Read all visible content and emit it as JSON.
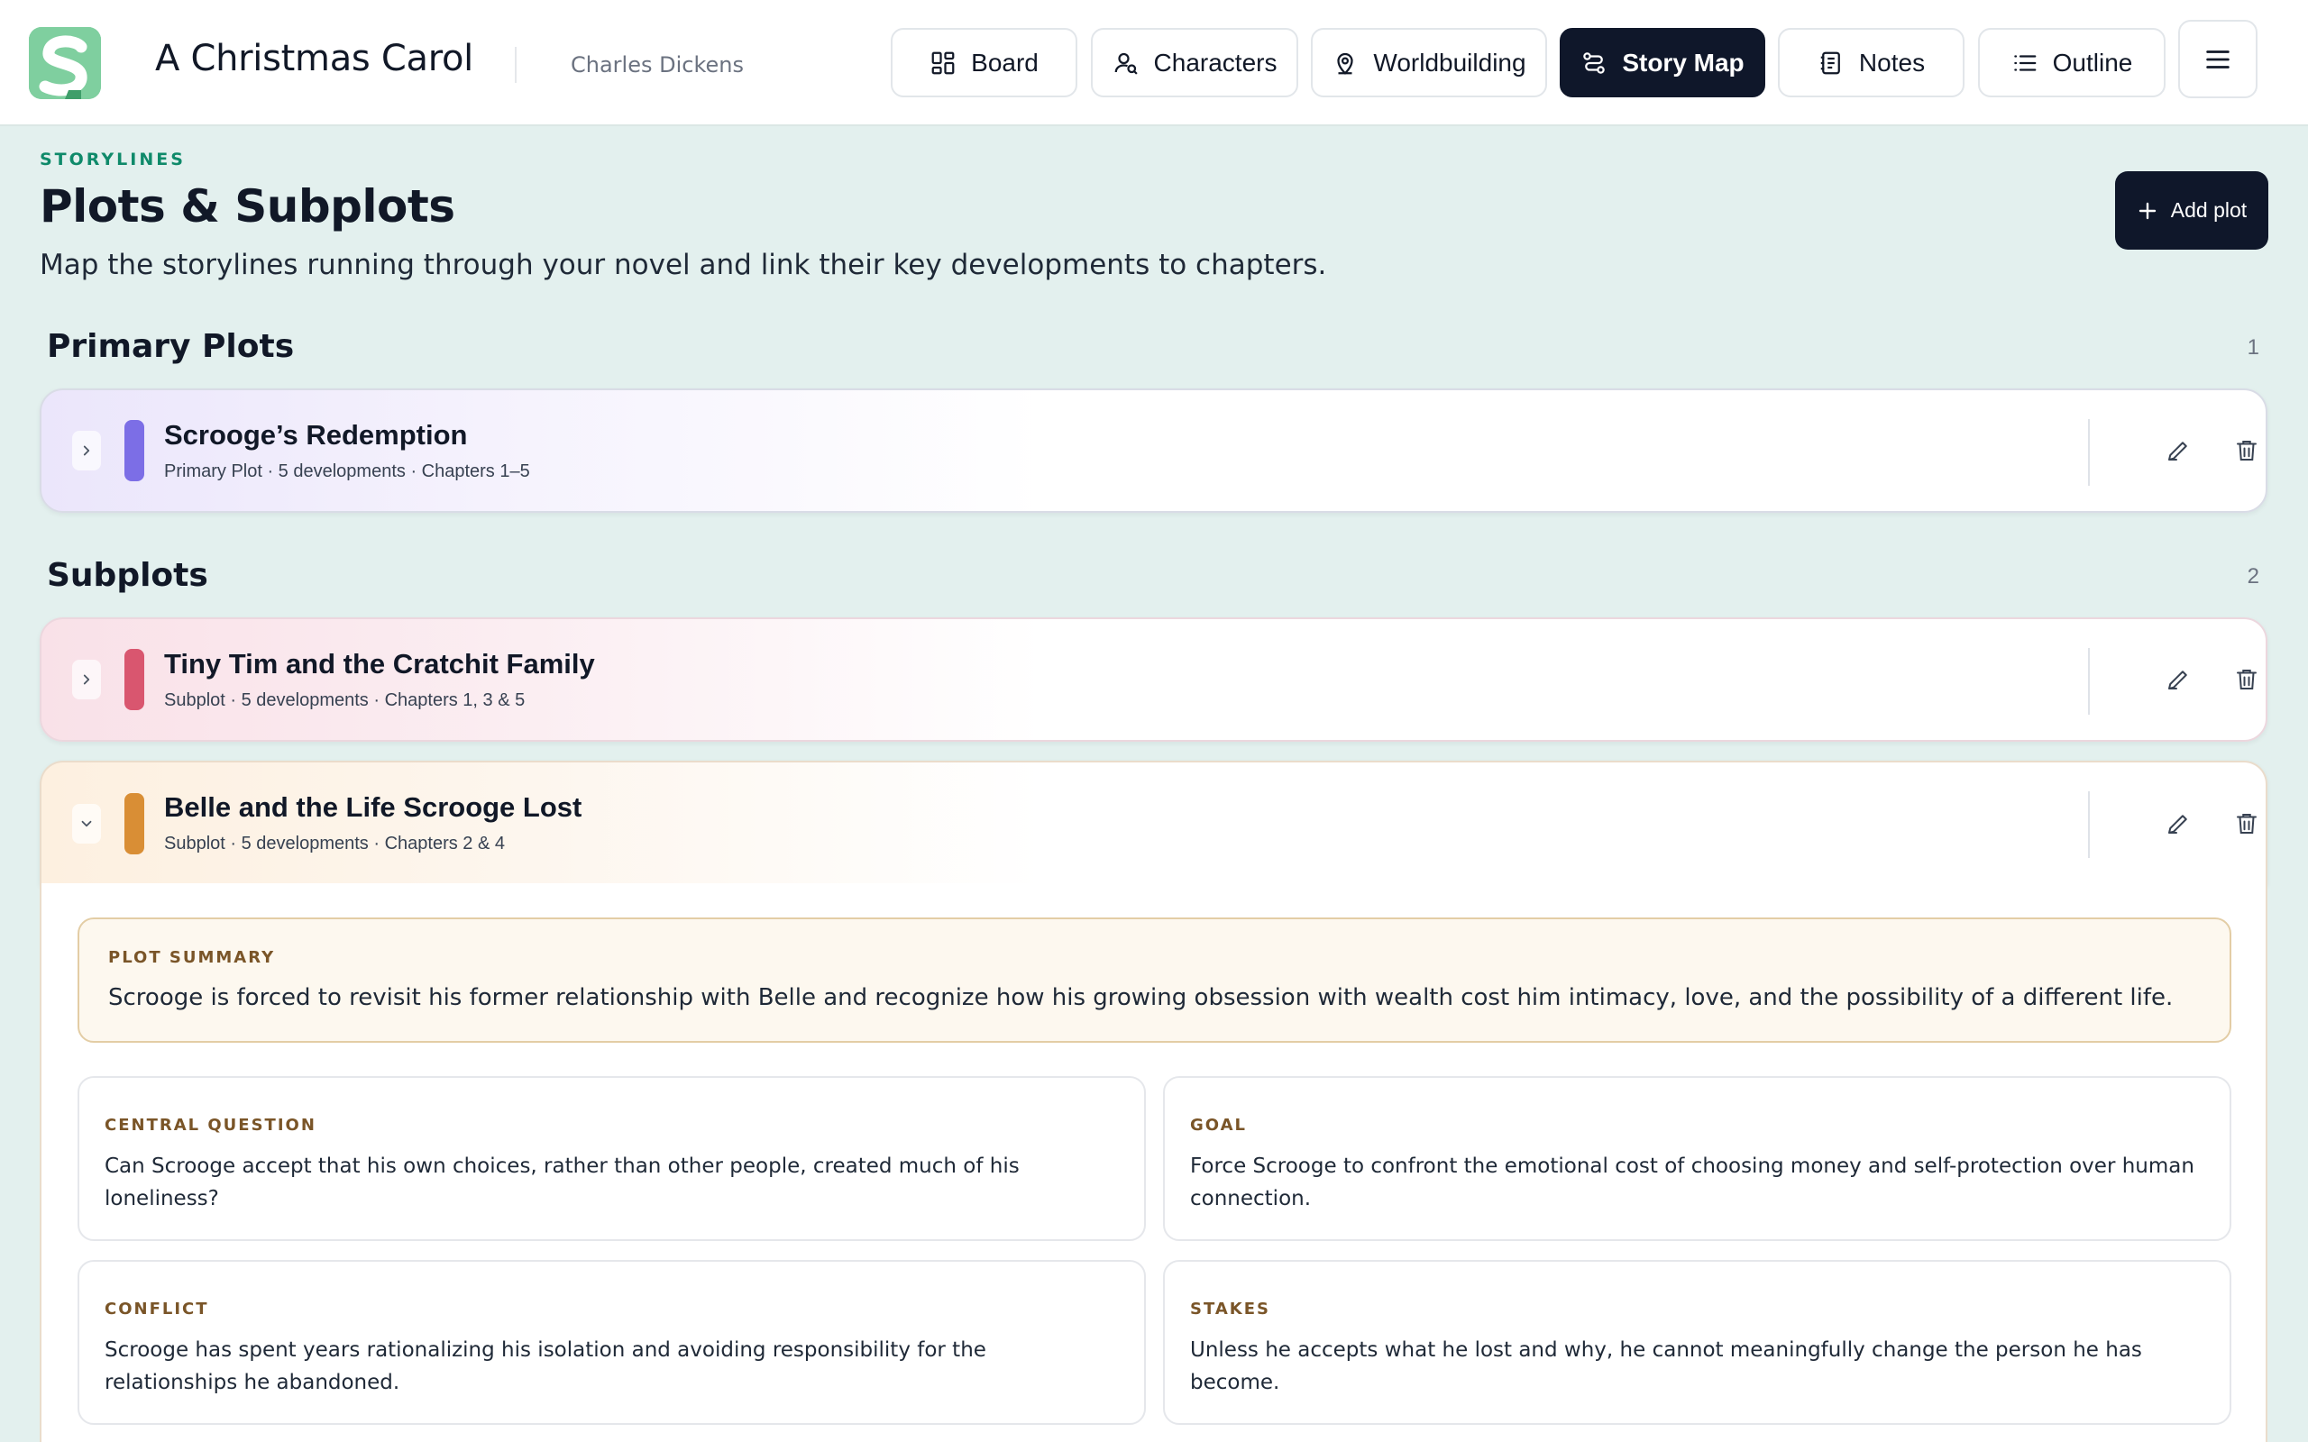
{
  "app": {
    "title": "A Christmas Carol",
    "author": "Charles Dickens"
  },
  "nav": {
    "board": "Board",
    "characters": "Characters",
    "worldbuilding": "Worldbuilding",
    "story_map": "Story Map",
    "notes": "Notes",
    "outline": "Outline",
    "active": "Story Map"
  },
  "page": {
    "eyebrow": "STORYLINES",
    "title": "Plots & Subplots",
    "subtitle": "Map the storylines running through your novel and link their key developments to chapters.",
    "add_button": "Add plot"
  },
  "sections": {
    "primary": {
      "title": "Primary Plots",
      "count": "1"
    },
    "subplots": {
      "title": "Subplots",
      "count": "2"
    }
  },
  "plots": [
    {
      "name": "Scrooge’s Redemption",
      "meta": "Primary Plot · 5 developments · Chapters 1–5",
      "color": "#7c6ee6",
      "expanded": false
    },
    {
      "name": "Tiny Tim and the Cratchit Family",
      "meta": "Subplot · 5 developments · Chapters 1, 3 & 5",
      "color": "#d9566f",
      "expanded": false
    },
    {
      "name": "Belle and the Life Scrooge Lost",
      "meta": "Subplot · 5 developments · Chapters 2 & 4",
      "color": "#d98e35",
      "expanded": true
    }
  ],
  "expanded_plot": {
    "summary_label": "PLOT SUMMARY",
    "summary": "Scrooge is forced to revisit his former relationship with Belle and recognize how his growing obsession with wealth cost him intimacy, love, and the possibility of a different life.",
    "fields": [
      {
        "label": "CENTRAL QUESTION",
        "text": "Can Scrooge accept that his own choices, rather than other people, created much of his loneliness?"
      },
      {
        "label": "GOAL",
        "text": "Force Scrooge to confront the emotional cost of choosing money and self-protection over human connection."
      },
      {
        "label": "CONFLICT",
        "text": "Scrooge has spent years rationalizing his isolation and avoiding responsibility for the relationships he abandoned."
      },
      {
        "label": "STAKES",
        "text": "Unless he accepts what he lost and why, he cannot meaningfully change the person he has become."
      }
    ]
  },
  "icons": {
    "board": "grid-icon",
    "characters": "person-search-icon",
    "worldbuilding": "map-pin-icon",
    "story_map": "route-icon",
    "notes": "notebook-icon",
    "outline": "list-icon",
    "menu": "hamburger-icon",
    "add": "plus-icon",
    "edit": "pencil-icon",
    "delete": "trash-icon",
    "expand": "chevron-right-icon",
    "collapse": "chevron-down-icon"
  },
  "colors": {
    "accent_dark": "#0f172a",
    "eyebrow_green": "#0f8a6a",
    "page_bg": "#e3f0ee",
    "summary_bg": "#fdf8ef",
    "label_brown": "#7a5528"
  }
}
